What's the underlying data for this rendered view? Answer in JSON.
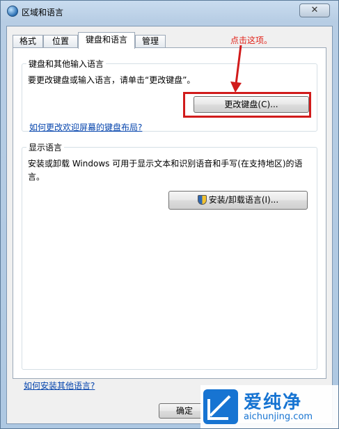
{
  "window": {
    "title": "区域和语言",
    "close_glyph": "✕"
  },
  "tabs": [
    {
      "label": "格式"
    },
    {
      "label": "位置"
    },
    {
      "label": "键盘和语言"
    },
    {
      "label": "管理"
    }
  ],
  "keyboard_group": {
    "legend": "键盘和其他输入语言",
    "description": "要更改键盘或输入语言，请单击“更改键盘”。",
    "button_label": "更改键盘(C)...",
    "link": "如何更改欢迎屏幕的键盘布局?"
  },
  "display_language_group": {
    "legend": "显示语言",
    "description": "安装或卸载 Windows 可用于显示文本和识别语音和手写(在支持地区)的语言。",
    "button_label": "安装/卸载语言(I)..."
  },
  "footer_link": "如何安装其他语言?",
  "footer_buttons": {
    "ok_label": "确定"
  },
  "annotation": {
    "callout_text": "点击这项。",
    "color": "#e2231a"
  },
  "watermark": {
    "main_text": "爱纯净",
    "url": "aichunjing.com"
  }
}
